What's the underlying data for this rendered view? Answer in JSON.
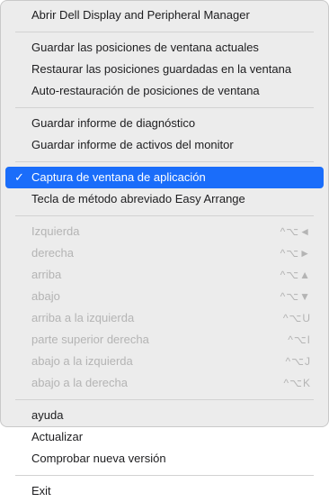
{
  "menu": {
    "group1": [
      "Abrir Dell Display and Peripheral Manager"
    ],
    "group2": [
      "Guardar las posiciones de ventana actuales",
      "Restaurar las posiciones guardadas en la ventana",
      "Auto-restauración de posiciones de ventana"
    ],
    "group3": [
      "Guardar informe de diagnóstico",
      "Guardar informe de activos del monitor"
    ],
    "group4": {
      "checkmark": "✓",
      "selected_item": "Captura de ventana de aplicación",
      "item2": "Tecla de método abreviado Easy Arrange"
    },
    "group5": [
      {
        "label": "Izquierda",
        "shortcut": "^⌥◄"
      },
      {
        "label": "derecha",
        "shortcut": "^⌥►"
      },
      {
        "label": "arriba",
        "shortcut": "^⌥▲"
      },
      {
        "label": "abajo",
        "shortcut": "^⌥▼"
      },
      {
        "label": "arriba a la izquierda",
        "shortcut": "^⌥U"
      },
      {
        "label": "parte superior derecha",
        "shortcut": "^⌥I"
      },
      {
        "label": "abajo a la izquierda",
        "shortcut": "^⌥J"
      },
      {
        "label": "abajo a la derecha",
        "shortcut": "^⌥K"
      }
    ],
    "group6": [
      "ayuda",
      "Actualizar",
      "Comprobar nueva versión"
    ],
    "group7": [
      "Exit"
    ]
  },
  "colors": {
    "menu_background": "#ececec",
    "highlight": "#1a6dfa",
    "disabled_text": "#b4b4b4"
  }
}
